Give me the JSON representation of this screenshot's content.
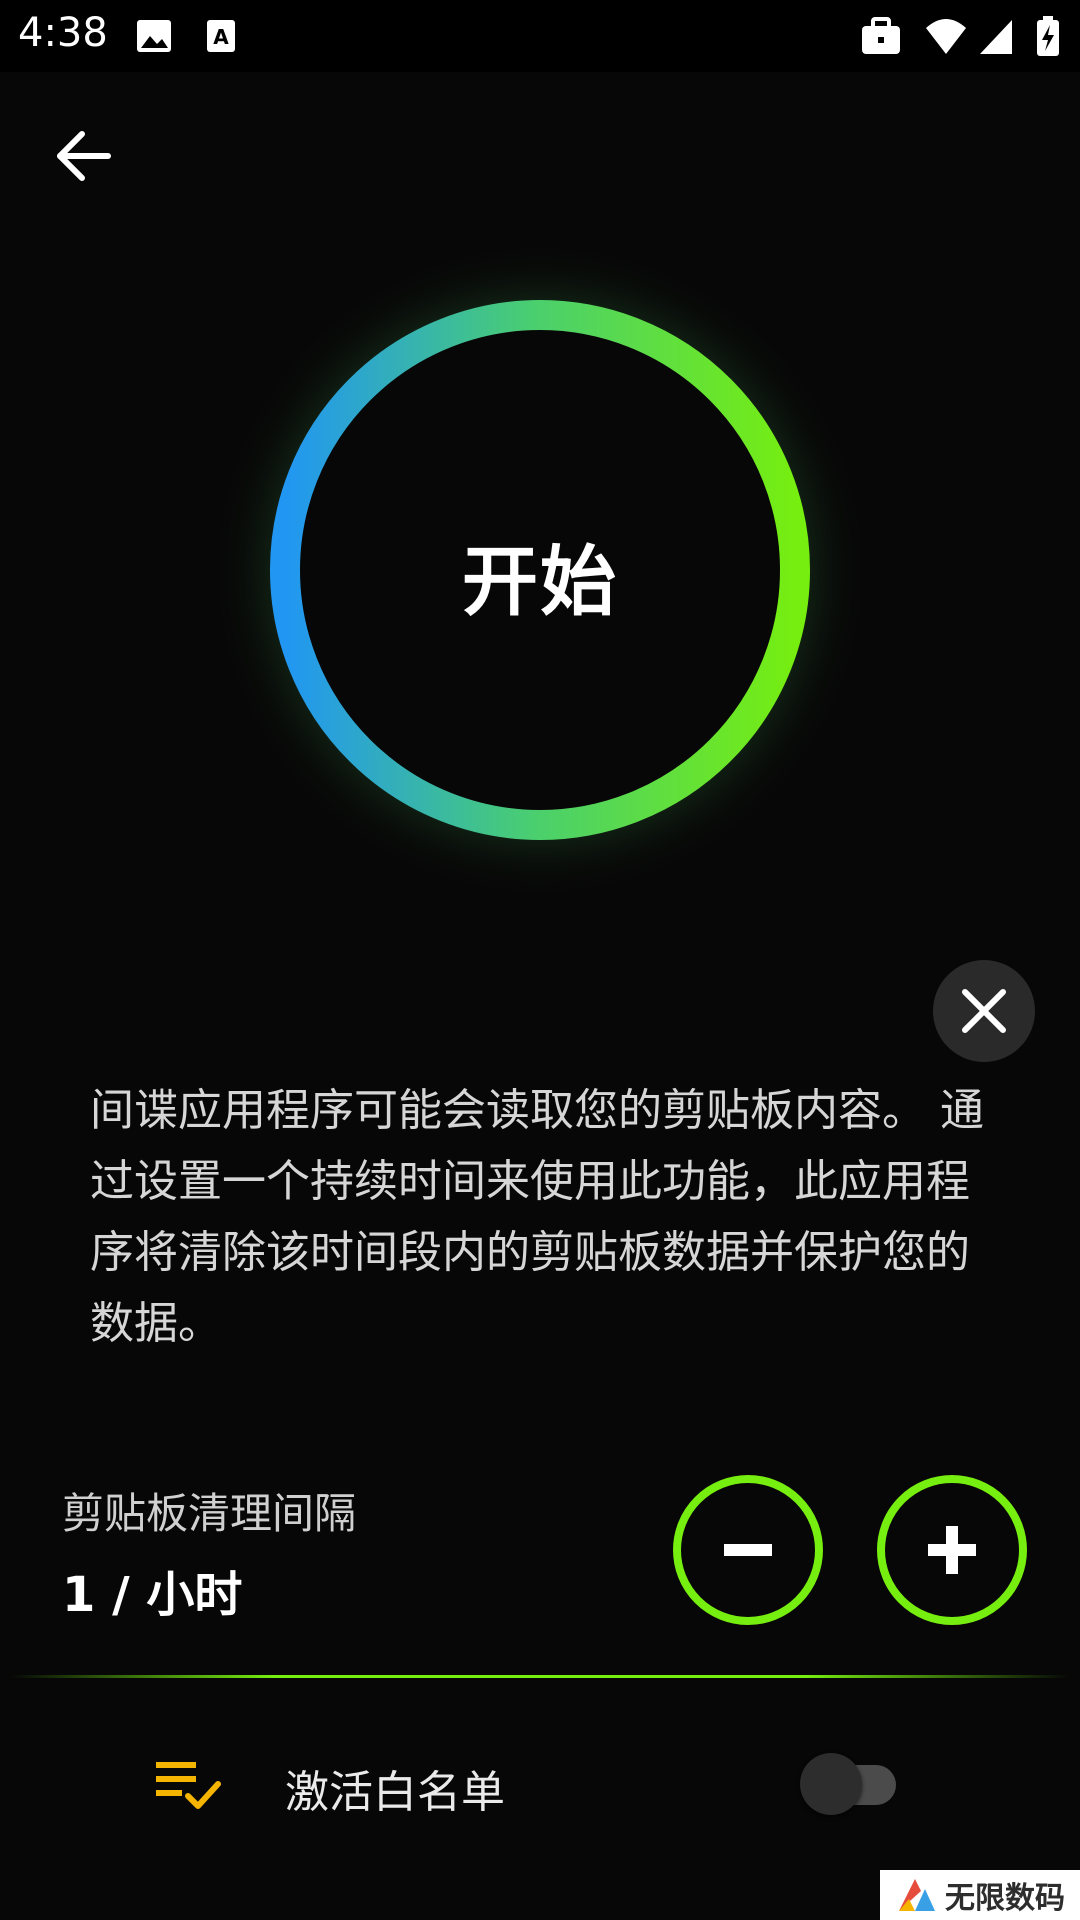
{
  "status_bar": {
    "time": "4:38"
  },
  "main": {
    "start_label": "开始",
    "description": "间谍应用程序可能会读取您的剪贴板内容。 通过设置一个持续时间来使用此功能，此应用程序将清除该时间段内的剪贴板数据并保护您的数据。",
    "interval": {
      "title": "剪贴板清理间隔",
      "value": "1 / 小时"
    }
  },
  "whitelist": {
    "label": "激活白名单",
    "enabled": false
  },
  "watermark": {
    "text": "无限数码"
  },
  "colors": {
    "ring_start": "#2196f3",
    "ring_end": "#76ee10",
    "accent": "#76ee10",
    "whitelist_icon": "#f5b400"
  }
}
